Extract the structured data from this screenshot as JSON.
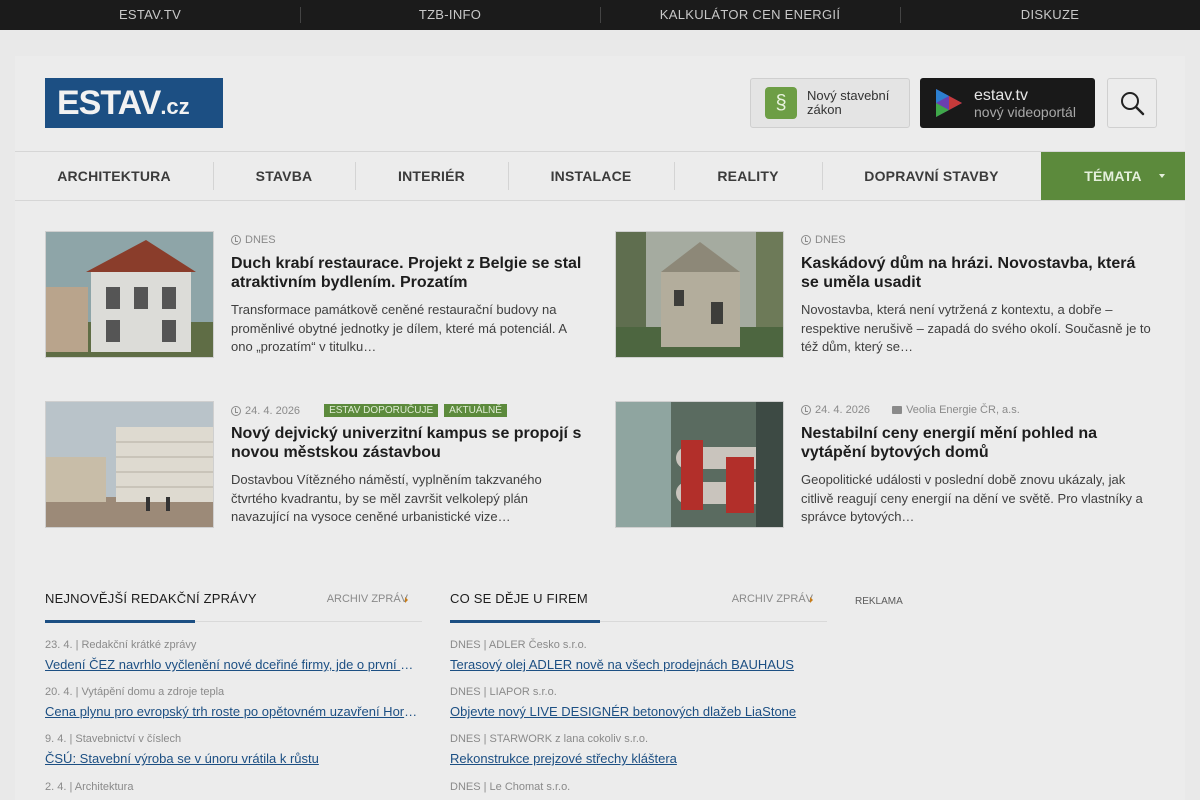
{
  "topbar": [
    "ESTAV.TV",
    "TZB-INFO",
    "KALKULÁTOR CEN ENERGIÍ",
    "DISKUZE"
  ],
  "logo": {
    "main": "ESTAV",
    "suffix": ".cz"
  },
  "law_button": {
    "label": "Nový stavební zákon",
    "icon": "paragraph-icon"
  },
  "tv_button": {
    "title": "estav.tv",
    "subtitle": "nový videoportál",
    "icon": "play-icon"
  },
  "search": {
    "icon": "search-icon"
  },
  "nav": [
    "ARCHITEKTURA",
    "STAVBA",
    "INTERIÉR",
    "INSTALACE",
    "REALITY",
    "DOPRAVNÍ STAVBY",
    "TÉMATA"
  ],
  "articles": [
    {
      "date": "DNES",
      "title": "Duch krabí restaurace. Projekt z Belgie se stal atraktivním bydlením. Prozatím",
      "excerpt": "Transformace památkově ceněné restaurační budovy na proměnlivé obytné jednotky je dílem, které má potenciál. A ono „prozatím“ v titulku…"
    },
    {
      "date": "DNES",
      "title": "Kaskádový dům na hrázi. Novostavba, která se uměla usadit",
      "excerpt": "Novostavba, která není vytržená z kontextu, a dobře – respektive nerušivě – zapadá do svého okolí. Současně je to též dům, který se…"
    },
    {
      "date": "24. 4. 2026",
      "badges": [
        "ESTAV DOPORUČUJE",
        "AKTUÁLNĚ"
      ],
      "title": "Nový dejvický univerzitní kampus se propojí s novou městskou zástavbou",
      "excerpt": "Dostavbou Vítězného náměstí, vyplněním takzvaného čtvrtého kvadrantu, by se měl završit velkolepý plán navazující na vysoce ceněné urbanistické vize…"
    },
    {
      "date": "24. 4. 2026",
      "company": "Veolia Energie ČR, a.s.",
      "title": "Nestabilní ceny energií mění pohled na vytápění bytových domů",
      "excerpt": "Geopolitické události v poslední době znovu ukázaly, jak citlivě reagují ceny energií na dění ve světě. Pro vlastníky a správce bytových…"
    }
  ],
  "editorial": {
    "heading": "NEJNOVĚJŠÍ REDAKČNÍ ZPRÁVY",
    "archive": "ARCHIV ZPRÁV",
    "items": [
      {
        "meta": "23. 4. | Redakční krátké zprávy",
        "title": "Vedení ČEZ navrhlo vyčlenění nové dceřiné firmy, jde o první krok ke zestátnění"
      },
      {
        "meta": "20. 4. | Vytápění domu a zdroje tepla",
        "title": "Cena plynu pro evropský trh roste po opětovném uzavření Hormuzského průlivu"
      },
      {
        "meta": "9. 4. | Stavebnictví v číslech",
        "title": "ČSÚ: Stavební výroba se v únoru vrátila k růstu"
      },
      {
        "meta": "2. 4. | Architektura",
        "title": ""
      }
    ]
  },
  "firms": {
    "heading": "CO SE DĚJE U FIREM",
    "archive": "ARCHIV ZPRÁV",
    "items": [
      {
        "meta": "DNES | ADLER Česko s.r.o.",
        "title": "Terasový olej ADLER nově na všech prodejnách BAUHAUS"
      },
      {
        "meta": "DNES | LIAPOR s.r.o.",
        "title": "Objevte nový LIVE DESIGNÉR betonových dlažeb LiaStone"
      },
      {
        "meta": "DNES | STARWORK z lana cokoliv s.r.o.",
        "title": "Rekonstrukce prejzové střechy kláštera"
      },
      {
        "meta": "DNES | Le Chomat s.r.o.",
        "title": ""
      }
    ]
  },
  "ad_label": "REKLAMA"
}
